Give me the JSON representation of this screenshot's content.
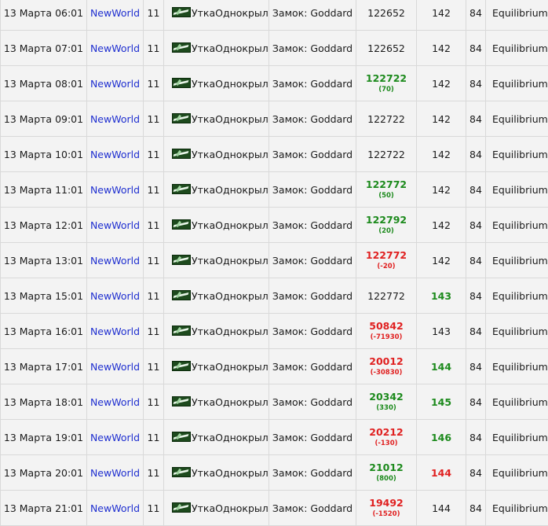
{
  "colors": {
    "link": "#1f2fd0",
    "increase": "#1c8a1c",
    "decrease": "#e02020",
    "row_bg": "#f3f3f3",
    "border": "#d9d9d9"
  },
  "rows": [
    {
      "date": "13 Марта 06:01",
      "world": "NewWorld",
      "num": "11",
      "character": "УткаОднокрыл",
      "castle": "Замок: Goddard",
      "rep": "122652",
      "diff": "",
      "trend": "flat",
      "level": "142",
      "level_trend": "flat",
      "col8": "84",
      "clan": "Equilibrium"
    },
    {
      "date": "13 Марта 07:01",
      "world": "NewWorld",
      "num": "11",
      "character": "УткаОднокрыл",
      "castle": "Замок: Goddard",
      "rep": "122652",
      "diff": "",
      "trend": "flat",
      "level": "142",
      "level_trend": "flat",
      "col8": "84",
      "clan": "Equilibrium"
    },
    {
      "date": "13 Марта 08:01",
      "world": "NewWorld",
      "num": "11",
      "character": "УткаОднокрыл",
      "castle": "Замок: Goddard",
      "rep": "122722",
      "diff": "(70)",
      "trend": "up",
      "level": "142",
      "level_trend": "flat",
      "col8": "84",
      "clan": "Equilibrium"
    },
    {
      "date": "13 Марта 09:01",
      "world": "NewWorld",
      "num": "11",
      "character": "УткаОднокрыл",
      "castle": "Замок: Goddard",
      "rep": "122722",
      "diff": "",
      "trend": "flat",
      "level": "142",
      "level_trend": "flat",
      "col8": "84",
      "clan": "Equilibrium"
    },
    {
      "date": "13 Марта 10:01",
      "world": "NewWorld",
      "num": "11",
      "character": "УткаОднокрыл",
      "castle": "Замок: Goddard",
      "rep": "122722",
      "diff": "",
      "trend": "flat",
      "level": "142",
      "level_trend": "flat",
      "col8": "84",
      "clan": "Equilibrium"
    },
    {
      "date": "13 Марта 11:01",
      "world": "NewWorld",
      "num": "11",
      "character": "УткаОднокрыл",
      "castle": "Замок: Goddard",
      "rep": "122772",
      "diff": "(50)",
      "trend": "up",
      "level": "142",
      "level_trend": "flat",
      "col8": "84",
      "clan": "Equilibrium"
    },
    {
      "date": "13 Марта 12:01",
      "world": "NewWorld",
      "num": "11",
      "character": "УткаОднокрыл",
      "castle": "Замок: Goddard",
      "rep": "122792",
      "diff": "(20)",
      "trend": "up",
      "level": "142",
      "level_trend": "flat",
      "col8": "84",
      "clan": "Equilibrium"
    },
    {
      "date": "13 Марта 13:01",
      "world": "NewWorld",
      "num": "11",
      "character": "УткаОднокрыл",
      "castle": "Замок: Goddard",
      "rep": "122772",
      "diff": "(-20)",
      "trend": "down",
      "level": "142",
      "level_trend": "flat",
      "col8": "84",
      "clan": "Equilibrium"
    },
    {
      "date": "13 Марта 15:01",
      "world": "NewWorld",
      "num": "11",
      "character": "УткаОднокрыл",
      "castle": "Замок: Goddard",
      "rep": "122772",
      "diff": "",
      "trend": "flat",
      "level": "143",
      "level_trend": "up",
      "col8": "84",
      "clan": "Equilibrium"
    },
    {
      "date": "13 Марта 16:01",
      "world": "NewWorld",
      "num": "11",
      "character": "УткаОднокрыл",
      "castle": "Замок: Goddard",
      "rep": "50842",
      "diff": "(-71930)",
      "trend": "down",
      "level": "143",
      "level_trend": "flat",
      "col8": "84",
      "clan": "Equilibrium"
    },
    {
      "date": "13 Марта 17:01",
      "world": "NewWorld",
      "num": "11",
      "character": "УткаОднокрыл",
      "castle": "Замок: Goddard",
      "rep": "20012",
      "diff": "(-30830)",
      "trend": "down",
      "level": "144",
      "level_trend": "up",
      "col8": "84",
      "clan": "Equilibrium"
    },
    {
      "date": "13 Марта 18:01",
      "world": "NewWorld",
      "num": "11",
      "character": "УткаОднокрыл",
      "castle": "Замок: Goddard",
      "rep": "20342",
      "diff": "(330)",
      "trend": "up",
      "level": "145",
      "level_trend": "up",
      "col8": "84",
      "clan": "Equilibrium"
    },
    {
      "date": "13 Марта 19:01",
      "world": "NewWorld",
      "num": "11",
      "character": "УткаОднокрыл",
      "castle": "Замок: Goddard",
      "rep": "20212",
      "diff": "(-130)",
      "trend": "down",
      "level": "146",
      "level_trend": "up",
      "col8": "84",
      "clan": "Equilibrium"
    },
    {
      "date": "13 Марта 20:01",
      "world": "NewWorld",
      "num": "11",
      "character": "УткаОднокрыл",
      "castle": "Замок: Goddard",
      "rep": "21012",
      "diff": "(800)",
      "trend": "up",
      "level": "144",
      "level_trend": "down",
      "col8": "84",
      "clan": "Equilibrium"
    },
    {
      "date": "13 Марта 21:01",
      "world": "NewWorld",
      "num": "11",
      "character": "УткаОднокрыл",
      "castle": "Замок: Goddard",
      "rep": "19492",
      "diff": "(-1520)",
      "trend": "down",
      "level": "144",
      "level_trend": "flat",
      "col8": "84",
      "clan": "Equilibrium"
    }
  ]
}
